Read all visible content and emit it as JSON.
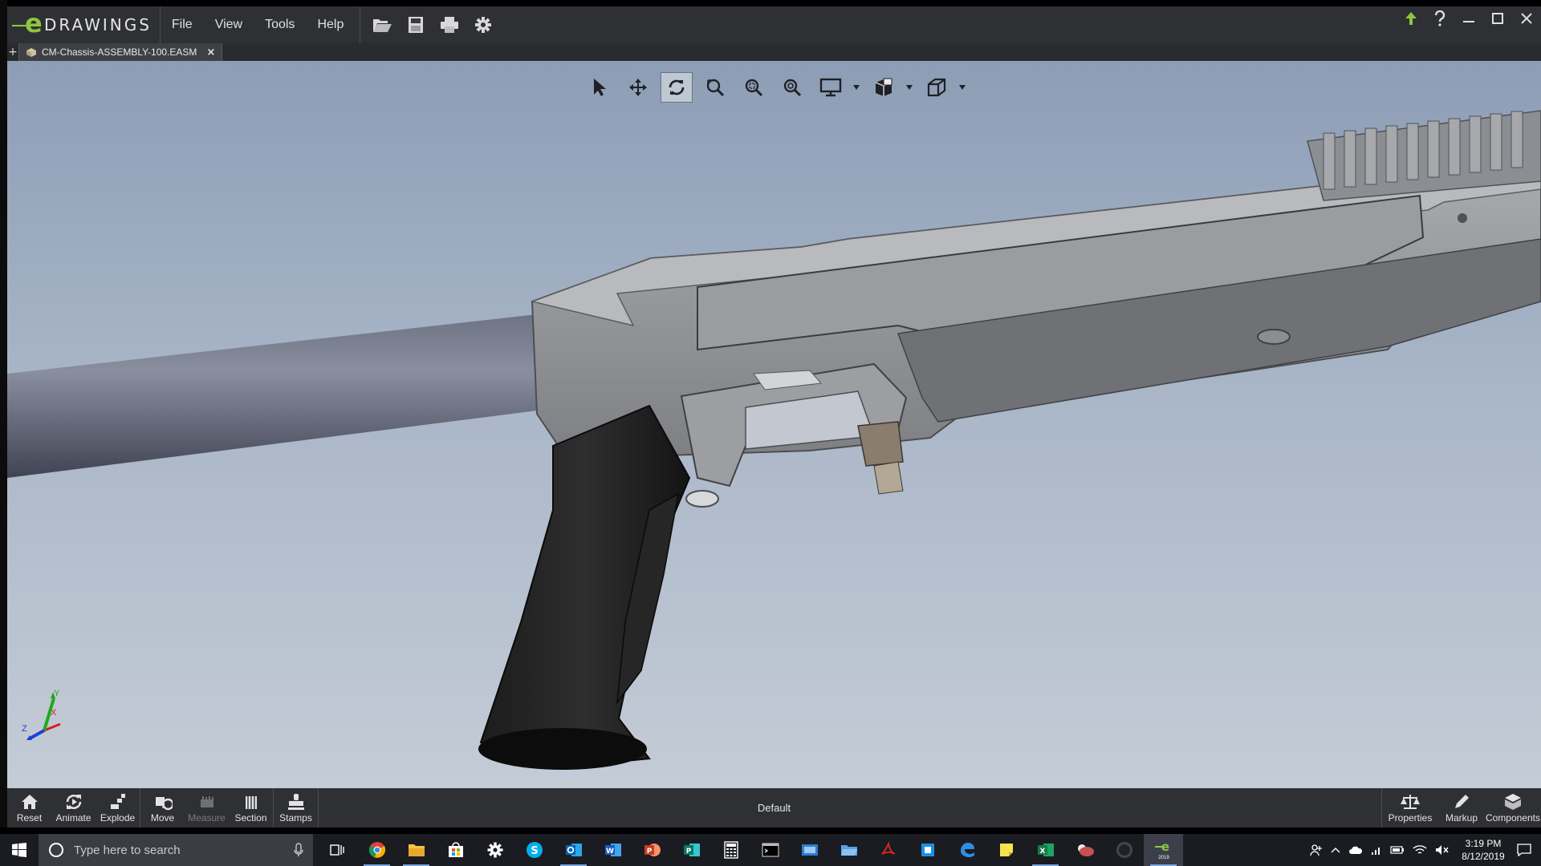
{
  "app": {
    "logo_text": "DRAWINGS",
    "logo_letter": "e",
    "menus": [
      "File",
      "View",
      "Tools",
      "Help"
    ],
    "tab_plus": "+",
    "tab_title": "CM-Chassis-ASSEMBLY-100.EASM",
    "tab_close": "×"
  },
  "colors": {
    "brand": "#8dc63f",
    "viewport_top": "#8d9db5",
    "viewport_bottom": "#c4ccd6",
    "toolbar": "#2f3033",
    "taskbar": "#1a1c22"
  },
  "title_icons": [
    "open-file-icon",
    "save-icon",
    "print-icon",
    "settings-gear-icon"
  ],
  "window_buttons": [
    "upload-arrow-icon",
    "help-icon",
    "minimize-icon",
    "maximize-icon",
    "close-icon"
  ],
  "heads_up_toolbar": [
    "select",
    "pan",
    "rotate",
    "zoom-to-fit",
    "zoom-to-area",
    "zoom-in-out",
    "display-style",
    "view-orientation",
    "section-view"
  ],
  "triad": {
    "x": "X",
    "y": "Y",
    "z": "Z"
  },
  "bottom_toolbar": {
    "left": [
      {
        "label": "Reset",
        "icon": "home-icon",
        "enabled": true
      },
      {
        "label": "Animate",
        "icon": "animate-icon",
        "enabled": true
      },
      {
        "label": "Explode",
        "icon": "explode-icon",
        "enabled": true
      },
      {
        "label": "Move",
        "icon": "move-icon",
        "enabled": true
      },
      {
        "label": "Measure",
        "icon": "measure-icon",
        "enabled": false
      },
      {
        "label": "Section",
        "icon": "section-icon",
        "enabled": true
      },
      {
        "label": "Stamps",
        "icon": "stamps-icon",
        "enabled": true
      }
    ],
    "configuration": "Default",
    "right": [
      {
        "label": "Properties",
        "icon": "properties-icon"
      },
      {
        "label": "Markup",
        "icon": "markup-icon"
      },
      {
        "label": "Components",
        "icon": "components-icon"
      }
    ]
  },
  "taskbar": {
    "search_placeholder": "Type here to search",
    "apps": [
      "task-view",
      "chrome",
      "file-explorer",
      "store",
      "settings",
      "skype",
      "outlook",
      "word",
      "powerpoint",
      "publisher",
      "calculator",
      "terminal",
      "app-blue",
      "app-folder",
      "acrobat",
      "app-box",
      "edge",
      "sticky-notes",
      "excel",
      "weather",
      "app-dark",
      "edrawings"
    ],
    "edrawings_badge": "2019",
    "time": "3:19 PM",
    "date": "8/12/2019"
  }
}
